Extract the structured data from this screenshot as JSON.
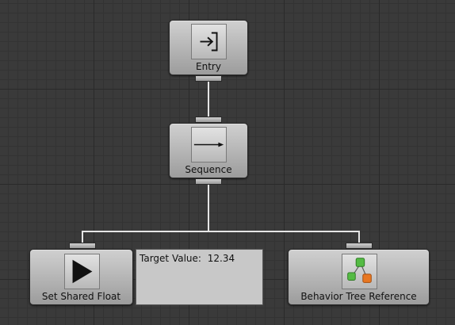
{
  "graph": {
    "nodes": {
      "entry": {
        "label": "Entry",
        "icon": "entry-icon"
      },
      "sequence": {
        "label": "Sequence",
        "icon": "arrow-right-icon"
      },
      "set_shared_float": {
        "label": "Set Shared Float",
        "icon": "play-icon"
      },
      "behavior_tree_reference": {
        "label": "Behavior Tree Reference",
        "icon": "tree-icon"
      }
    },
    "comment": {
      "field_label": "Target Value:",
      "field_value": "12.34"
    }
  },
  "colors": {
    "background": "#3a3a3a",
    "grid_minor": "#333333",
    "grid_major": "#2a2a2a",
    "node_top": "#d0d0d0",
    "node_bottom": "#9c9c9c",
    "connection": "#e6e6e6",
    "comment_bg": "#c8c8c8",
    "tree_node_green": "#55bb44",
    "tree_node_orange": "#e87722"
  }
}
